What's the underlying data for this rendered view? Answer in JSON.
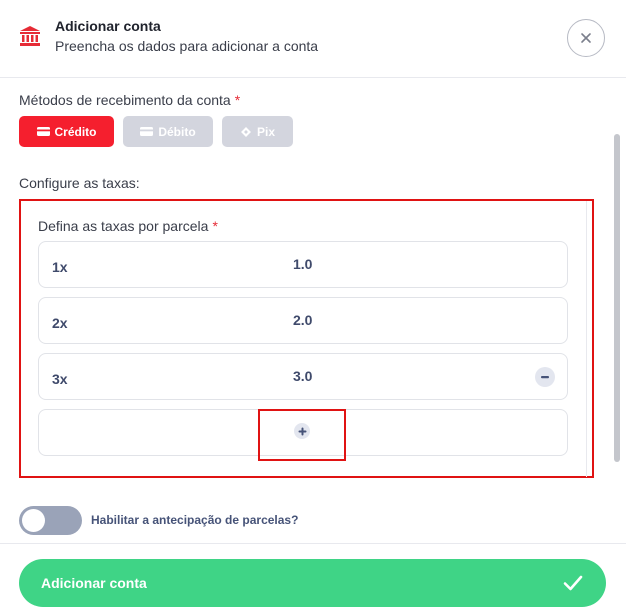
{
  "header": {
    "title": "Adicionar conta",
    "subtitle": "Preencha os dados para adicionar a conta",
    "icon": "bank-icon",
    "close_icon": "close-icon"
  },
  "methods": {
    "label": "Métodos de recebimento da conta",
    "required_mark": "*",
    "items": [
      {
        "label": "Crédito",
        "icon": "card-icon",
        "active": true
      },
      {
        "label": "Débito",
        "icon": "card-icon",
        "active": false
      },
      {
        "label": "Pix",
        "icon": "pix-icon",
        "active": false
      }
    ]
  },
  "taxes": {
    "section_label": "Configure as taxas:",
    "installments_label": "Defina as taxas por parcela",
    "required_mark": "*",
    "rows": [
      {
        "installment": "1x",
        "rate": "1.0"
      },
      {
        "installment": "2x",
        "rate": "2.0"
      },
      {
        "installment": "3x",
        "rate": "3.0"
      }
    ],
    "add_icon": "plus-icon",
    "remove_icon": "minus-icon"
  },
  "anticipation": {
    "label": "Habilitar a antecipação de parcelas?",
    "enabled": false
  },
  "submit": {
    "label": "Adicionar conta",
    "icon": "check-icon"
  },
  "colors": {
    "accent_red": "#f51f2e",
    "success_green": "#3fd486",
    "highlight_red": "#e01313",
    "text_navy": "#3f4a6b"
  }
}
